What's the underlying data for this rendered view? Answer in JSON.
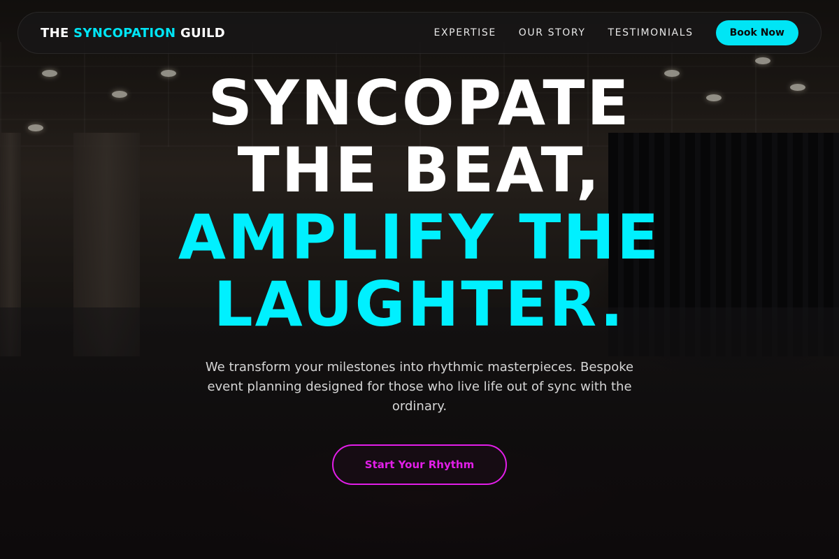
{
  "brand": {
    "prefix": "THE ",
    "accent": "SYNCOPATION",
    "suffix": " GUILD"
  },
  "nav": {
    "links": [
      "EXPERTISE",
      "OUR STORY",
      "TESTIMONIALS"
    ],
    "book_label": "Book Now"
  },
  "hero": {
    "headline_white_1": "SYNCOPATE",
    "headline_white_2": "THE BEAT,",
    "headline_cyan_1": "AMPLIFY THE",
    "headline_cyan_2": "LAUGHTER.",
    "subtext": "We transform your milestones into rhythmic masterpieces. Bespoke event planning designed for those who live life out of sync with the ordinary.",
    "cta_label": "Start Your Rhythm"
  },
  "colors": {
    "accent_cyan": "#00e5f5",
    "accent_magenta": "#e21ee8",
    "nav_bg": "#181616"
  }
}
